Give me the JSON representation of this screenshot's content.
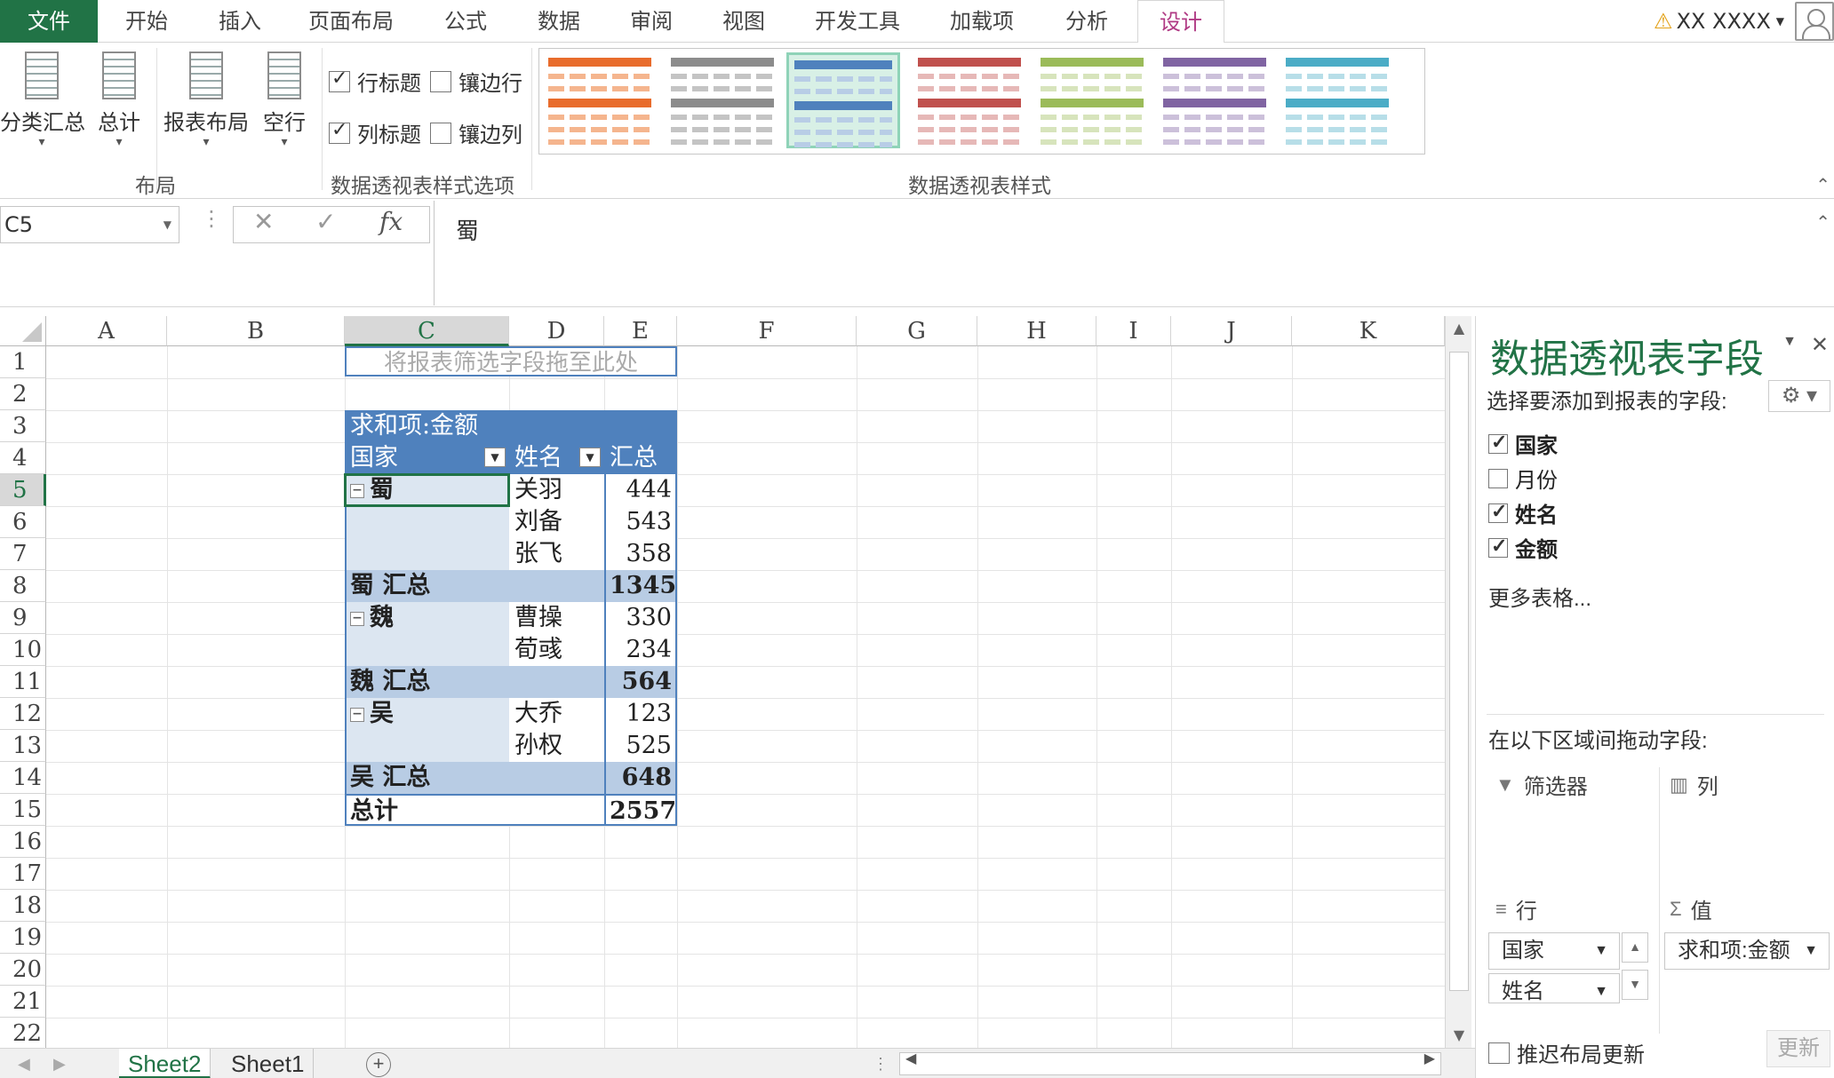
{
  "ribbon_tabs": [
    "文件",
    "开始",
    "插入",
    "页面布局",
    "公式",
    "数据",
    "审阅",
    "视图",
    "开发工具",
    "加载项",
    "分析",
    "设计"
  ],
  "active_tab": "设计",
  "user": {
    "name": "XX XXXX"
  },
  "ribbon": {
    "layout": {
      "subtotal": "分类汇总",
      "grand_total": "总计",
      "report_layout": "报表布局",
      "blank_rows": "空行",
      "group_label": "布局"
    },
    "style_options": {
      "row_headers": "行标题",
      "banded_rows": "镶边行",
      "column_headers": "列标题",
      "banded_columns": "镶边列",
      "group_label": "数据透视表样式选项"
    },
    "styles": {
      "group_label": "数据透视表样式",
      "swatches": [
        {
          "header": "#e86c2c",
          "band": "#f5b58e"
        },
        {
          "header": "#8c8c8c",
          "band": "#c4c4c4"
        },
        {
          "header": "#4f81bd",
          "band": "#b8cde6"
        },
        {
          "header": "#c0504d",
          "band": "#e6b8b7"
        },
        {
          "header": "#9bbb59",
          "band": "#d7e4bc"
        },
        {
          "header": "#8064a2",
          "band": "#ccc0da"
        },
        {
          "header": "#4bacc6",
          "band": "#b7dee8"
        }
      ]
    }
  },
  "formula_bar": {
    "name_box": "C5",
    "fx": "fx",
    "formula": "蜀"
  },
  "columns": [
    "A",
    "B",
    "C",
    "D",
    "E",
    "F",
    "G",
    "H",
    "I",
    "J",
    "K"
  ],
  "rows": [
    "1",
    "2",
    "3",
    "4",
    "5",
    "6",
    "7",
    "8",
    "9",
    "10",
    "11",
    "12",
    "13",
    "14",
    "15",
    "16",
    "17",
    "18",
    "19",
    "20",
    "21",
    "22"
  ],
  "pivot": {
    "filter_placeholder": "将报表筛选字段拖至此处",
    "value_header": "求和项:金额",
    "row_label_1": "国家",
    "row_label_2": "姓名",
    "total_label": "汇总",
    "data": [
      {
        "country": "蜀",
        "name": "关羽",
        "value": "444"
      },
      {
        "country": "",
        "name": "刘备",
        "value": "543"
      },
      {
        "country": "",
        "name": "张飞",
        "value": "358"
      },
      {
        "subtotal": "蜀  汇总",
        "value": "1345"
      },
      {
        "country": "魏",
        "name": "曹操",
        "value": "330"
      },
      {
        "country": "",
        "name": "荀彧",
        "value": "234"
      },
      {
        "subtotal": "魏  汇总",
        "value": "564"
      },
      {
        "country": "吴",
        "name": "大乔",
        "value": "123"
      },
      {
        "country": "",
        "name": "孙权",
        "value": "525"
      },
      {
        "subtotal": "吴  汇总",
        "value": "648"
      }
    ],
    "grand_total_label": "总计",
    "grand_total_value": "2557",
    "accent": "#4f81bd",
    "band": "#dce6f1",
    "subtotal_band": "#b8cce4"
  },
  "sheets": [
    "Sheet2",
    "Sheet1"
  ],
  "panel": {
    "title": "数据透视表字段",
    "subtitle": "选择要添加到报表的字段:",
    "fields": [
      {
        "label": "国家",
        "checked": true
      },
      {
        "label": "月份",
        "checked": false
      },
      {
        "label": "姓名",
        "checked": true
      },
      {
        "label": "金额",
        "checked": true
      }
    ],
    "more_tables": "更多表格...",
    "drag_label": "在以下区域间拖动字段:",
    "filters": "筛选器",
    "columns": "列",
    "rows": "行",
    "values": "值",
    "row_fields": [
      "国家",
      "姓名"
    ],
    "value_field": "求和项:金额",
    "defer_update": "推迟布局更新",
    "update_button": "更新"
  }
}
